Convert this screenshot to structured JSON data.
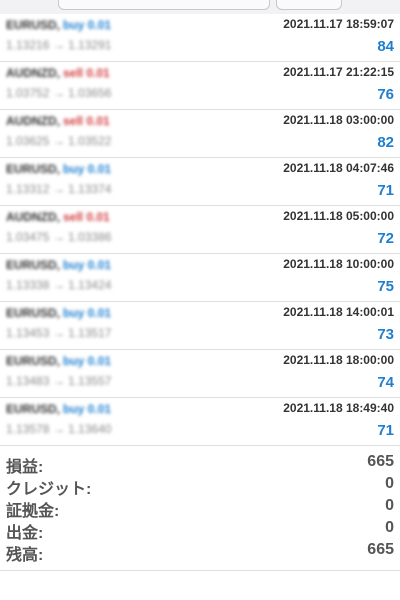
{
  "trades": [
    {
      "symbol": "EURUSD,",
      "side": "buy 0.01",
      "side_type": "buy",
      "prices": "1.13216 → 1.13291",
      "time": "2021.11.17 18:59:07",
      "profit": "84"
    },
    {
      "symbol": "AUDNZD,",
      "side": "sell 0.01",
      "side_type": "sell",
      "prices": "1.03752 → 1.03656",
      "time": "2021.11.17 21:22:15",
      "profit": "76"
    },
    {
      "symbol": "AUDNZD,",
      "side": "sell 0.01",
      "side_type": "sell",
      "prices": "1.03625 → 1.03522",
      "time": "2021.11.18 03:00:00",
      "profit": "82"
    },
    {
      "symbol": "EURUSD,",
      "side": "buy 0.01",
      "side_type": "buy",
      "prices": "1.13312 → 1.13374",
      "time": "2021.11.18 04:07:46",
      "profit": "71"
    },
    {
      "symbol": "AUDNZD,",
      "side": "sell 0.01",
      "side_type": "sell",
      "prices": "1.03475 → 1.03386",
      "time": "2021.11.18 05:00:00",
      "profit": "72"
    },
    {
      "symbol": "EURUSD,",
      "side": "buy 0.01",
      "side_type": "buy",
      "prices": "1.13338 → 1.13424",
      "time": "2021.11.18 10:00:00",
      "profit": "75"
    },
    {
      "symbol": "EURUSD,",
      "side": "buy 0.01",
      "side_type": "buy",
      "prices": "1.13453 → 1.13517",
      "time": "2021.11.18 14:00:01",
      "profit": "73"
    },
    {
      "symbol": "EURUSD,",
      "side": "buy 0.01",
      "side_type": "buy",
      "prices": "1.13483 → 1.13557",
      "time": "2021.11.18 18:00:00",
      "profit": "74"
    },
    {
      "symbol": "EURUSD,",
      "side": "buy 0.01",
      "side_type": "buy",
      "prices": "1.13578 → 1.13640",
      "time": "2021.11.18 18:49:40",
      "profit": "71"
    }
  ],
  "summary": {
    "profit_label": "損益:",
    "profit_value": "665",
    "credit_label": "クレジット:",
    "credit_value": "0",
    "margin_label": "証拠金:",
    "margin_value": "0",
    "withdrawal_label": "出金:",
    "withdrawal_value": "0",
    "balance_label": "残高:",
    "balance_value": "665"
  },
  "colors": {
    "profit_blue": "#1e7fd0",
    "buy_blue": "#1e7fd0",
    "sell_red": "#d23c3c"
  }
}
